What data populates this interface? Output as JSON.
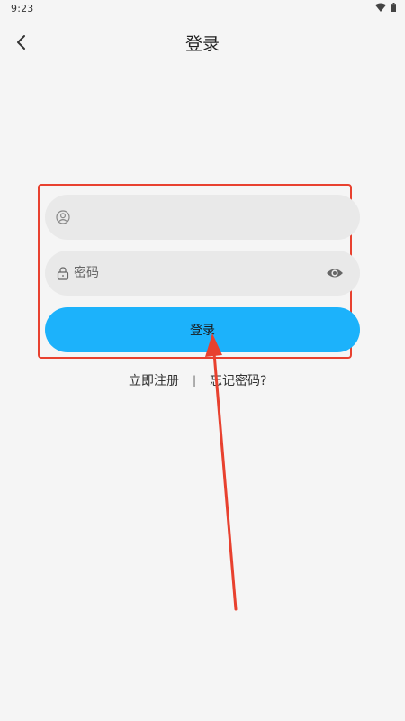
{
  "status_bar": {
    "time": "9:23",
    "icons": [
      "wifi-icon",
      "battery-icon"
    ]
  },
  "header": {
    "back_icon": "chevron-left-icon",
    "title": "登录"
  },
  "form": {
    "username": {
      "icon": "user-icon",
      "value": "",
      "placeholder": ""
    },
    "password": {
      "icon": "lock-icon",
      "value": "",
      "placeholder": "密码",
      "visibility_icon": "eye-icon"
    },
    "login_label": "登录"
  },
  "links": {
    "register": "立即注册",
    "separator": "|",
    "forgot": "忘记密码?"
  },
  "colors": {
    "background": "#f5f5f5",
    "field_background": "#e9e9e9",
    "primary_button": "#1cb2fb",
    "annotation": "#e8412f"
  }
}
